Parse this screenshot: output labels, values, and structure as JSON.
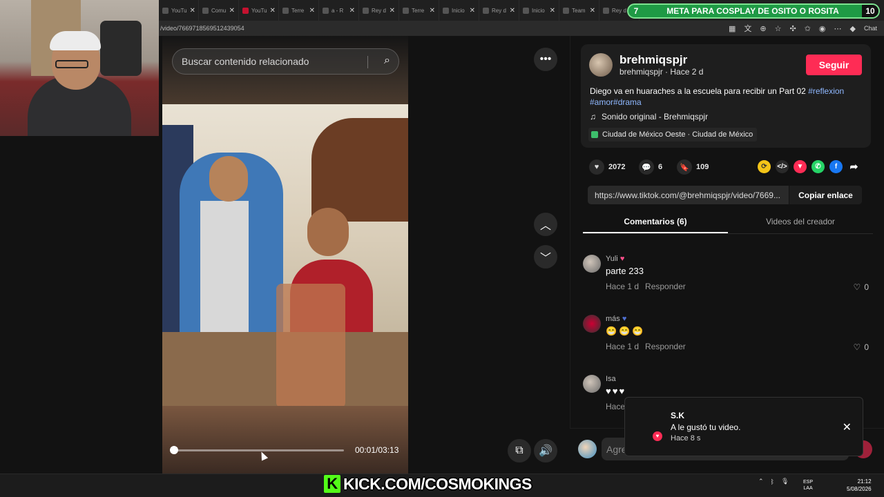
{
  "browser": {
    "tabs": [
      {
        "label": "YouTu"
      },
      {
        "label": "Comu"
      },
      {
        "label": "YouTu"
      },
      {
        "label": "Terre"
      },
      {
        "label": "a - R"
      },
      {
        "label": "Rey d"
      },
      {
        "label": "Terre"
      },
      {
        "label": "Inicio"
      },
      {
        "label": "Rey d"
      },
      {
        "label": "Inicio"
      },
      {
        "label": "Team"
      },
      {
        "label": "Rey d"
      }
    ],
    "address": "/video/7669718569512439054",
    "chat_label": "Chat"
  },
  "goal_overlay": {
    "left": "7",
    "text": "META PARA COSPLAY DE OSITO O ROSITA",
    "right": "10",
    "color": "#1f9a45"
  },
  "video": {
    "search_placeholder": "Buscar contenido relacionado",
    "time": "00:01/03:13",
    "progress": 0.005
  },
  "post": {
    "author": "brehmiqspjr",
    "author_sub": "brehmiqspjr · Hace 2 d",
    "follow_label": "Seguir",
    "description": "Diego va en huaraches a la escuela para recibir un Part 02 ",
    "tag1": "#reflexion",
    "tag2": "#amor#drama",
    "music": "Sonido original - Brehmiqspjr",
    "location": "Ciudad de México Oeste · Ciudad de México",
    "likes": "2072",
    "comments": "6",
    "saves": "109",
    "link": "https://www.tiktok.com/@brehmiqspjr/video/7669...",
    "copy_label": "Copiar enlace",
    "accent": "#fe2c55"
  },
  "tabs": {
    "comments": "Comentarios (6)",
    "creator": "Videos del creador"
  },
  "comments": [
    {
      "name": "Yuli",
      "text": "parte 233",
      "time": "Hace 1 d",
      "reply": "Responder",
      "likes": "0"
    },
    {
      "name": "más",
      "text": "",
      "time": "Hace 1 d",
      "reply": "Responder",
      "likes": "0"
    },
    {
      "name": "Isa",
      "text": "",
      "time": "Hace",
      "reply": "",
      "likes": ""
    }
  ],
  "composer": {
    "placeholder": "Agre"
  },
  "toast": {
    "title": "S.K",
    "message": "A le gustó tu video.",
    "time": "Hace 8 s"
  },
  "banner": {
    "text": "KICK.COM/COSMOKINGS"
  },
  "taskbar": {
    "lang_top": "ESP",
    "lang_bottom": "LAA",
    "time": "21:12",
    "date": "5/08/2026"
  }
}
